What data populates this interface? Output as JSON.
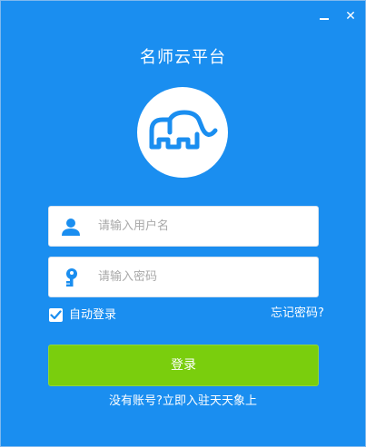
{
  "window": {
    "title": "名师云平台",
    "minimize_icon": "minimize-icon",
    "close_icon": "close-icon"
  },
  "login": {
    "username_placeholder": "请输入用户名",
    "username_value": "",
    "password_placeholder": "请输入密码",
    "password_value": "",
    "remember_label": "自动登录",
    "remember_checked": true,
    "forgot_label": "忘记密码?",
    "login_button": "登录",
    "register_link": "没有账号?立即入驻天天象上"
  },
  "colors": {
    "background": "#1a8ef0",
    "login_button": "#7ace0d",
    "logo_stroke": "#1a8ef0",
    "icon": "#1a8ef0"
  }
}
